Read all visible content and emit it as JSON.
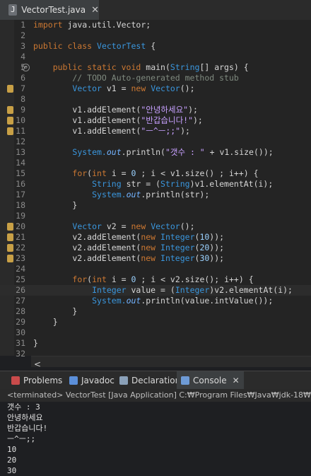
{
  "tab": {
    "title": "VectorTest.java",
    "close": "✕"
  },
  "code_lines": [
    {
      "n": "1",
      "parts": [
        [
          "kw",
          "import "
        ],
        [
          "",
          "java.util.Vector;"
        ]
      ]
    },
    {
      "n": "2",
      "parts": []
    },
    {
      "n": "3",
      "parts": [
        [
          "kw",
          "public class "
        ],
        [
          "ty",
          "VectorTest"
        ],
        [
          "",
          " {"
        ]
      ]
    },
    {
      "n": "4",
      "parts": []
    },
    {
      "n": "5",
      "parts": [
        [
          "",
          "    "
        ],
        [
          "kw",
          "public static void "
        ],
        [
          "fn",
          "main("
        ],
        [
          "ty",
          "String"
        ],
        [
          "",
          "[] args) {"
        ]
      ]
    },
    {
      "n": "6",
      "parts": [
        [
          "cm",
          "        // TODO Auto-generated method stub"
        ]
      ]
    },
    {
      "n": "7",
      "parts": [
        [
          "",
          "        "
        ],
        [
          "ty",
          "Vector"
        ],
        [
          "",
          " v1 = "
        ],
        [
          "kw",
          "new "
        ],
        [
          "ty",
          "Vector"
        ],
        [
          "",
          "();"
        ]
      ]
    },
    {
      "n": "8",
      "parts": []
    },
    {
      "n": "9",
      "parts": [
        [
          "",
          "        v1.addElement("
        ],
        [
          "str",
          "\"안녕하세요\""
        ],
        [
          "",
          ");"
        ]
      ]
    },
    {
      "n": "10",
      "parts": [
        [
          "",
          "        v1.addElement("
        ],
        [
          "str",
          "\"반갑습니다!\""
        ],
        [
          "",
          ");"
        ]
      ]
    },
    {
      "n": "11",
      "parts": [
        [
          "",
          "        v1.addElement("
        ],
        [
          "str",
          "\"ㅡ^ㅡ;;\""
        ],
        [
          "",
          ");"
        ]
      ]
    },
    {
      "n": "12",
      "parts": []
    },
    {
      "n": "13",
      "parts": [
        [
          "",
          "        "
        ],
        [
          "ty",
          "System."
        ],
        [
          "fld",
          "out"
        ],
        [
          "",
          ".println("
        ],
        [
          "str",
          "\"갯수 : \""
        ],
        [
          "",
          " + v1.size());"
        ]
      ]
    },
    {
      "n": "14",
      "parts": []
    },
    {
      "n": "15",
      "parts": [
        [
          "",
          "        "
        ],
        [
          "kw",
          "for"
        ],
        [
          "",
          "("
        ],
        [
          "kw",
          "int "
        ],
        [
          "",
          "i = "
        ],
        [
          "num",
          "0"
        ],
        [
          "",
          " ; i < v1.size() ; i++) {"
        ]
      ]
    },
    {
      "n": "16",
      "parts": [
        [
          "",
          "            "
        ],
        [
          "ty",
          "String"
        ],
        [
          "",
          " str = ("
        ],
        [
          "ty",
          "String"
        ],
        [
          "",
          ")v1.elementAt(i);"
        ]
      ]
    },
    {
      "n": "17",
      "parts": [
        [
          "",
          "            "
        ],
        [
          "ty",
          "System."
        ],
        [
          "fld",
          "out"
        ],
        [
          "",
          ".println(str);"
        ]
      ]
    },
    {
      "n": "18",
      "parts": [
        [
          "",
          "        }"
        ]
      ]
    },
    {
      "n": "19",
      "parts": []
    },
    {
      "n": "20",
      "parts": [
        [
          "",
          "        "
        ],
        [
          "ty",
          "Vector"
        ],
        [
          "",
          " v2 = "
        ],
        [
          "kw",
          "new "
        ],
        [
          "ty",
          "Vector"
        ],
        [
          "",
          "();"
        ]
      ]
    },
    {
      "n": "21",
      "parts": [
        [
          "",
          "        v2.addElement("
        ],
        [
          "kw",
          "new "
        ],
        [
          "ty",
          "Integer"
        ],
        [
          "",
          "("
        ],
        [
          "num",
          "10"
        ],
        [
          "",
          "));"
        ]
      ]
    },
    {
      "n": "22",
      "parts": [
        [
          "",
          "        v2.addElement("
        ],
        [
          "kw",
          "new "
        ],
        [
          "ty",
          "Integer"
        ],
        [
          "",
          "("
        ],
        [
          "num",
          "20"
        ],
        [
          "",
          "));"
        ]
      ]
    },
    {
      "n": "23",
      "parts": [
        [
          "",
          "        v2.addElement("
        ],
        [
          "kw",
          "new "
        ],
        [
          "ty",
          "Integer"
        ],
        [
          "",
          "("
        ],
        [
          "num",
          "30"
        ],
        [
          "",
          "));"
        ]
      ]
    },
    {
      "n": "24",
      "parts": []
    },
    {
      "n": "25",
      "parts": [
        [
          "",
          "        "
        ],
        [
          "kw",
          "for"
        ],
        [
          "",
          "("
        ],
        [
          "kw",
          "int "
        ],
        [
          "",
          "i = "
        ],
        [
          "num",
          "0"
        ],
        [
          "",
          " ; i < v2.size(); i++) {"
        ]
      ]
    },
    {
      "n": "26",
      "parts": [
        [
          "",
          "            "
        ],
        [
          "ty",
          "Integer"
        ],
        [
          "",
          " value = ("
        ],
        [
          "ty",
          "Integer"
        ],
        [
          "",
          ")v2.elementAt(i);"
        ]
      ]
    },
    {
      "n": "27",
      "parts": [
        [
          "",
          "            "
        ],
        [
          "ty",
          "System."
        ],
        [
          "fld",
          "out"
        ],
        [
          "",
          ".println(value.intValue());"
        ]
      ]
    },
    {
      "n": "28",
      "parts": [
        [
          "",
          "        }"
        ]
      ]
    },
    {
      "n": "29",
      "parts": [
        [
          "",
          "    }"
        ]
      ]
    },
    {
      "n": "30",
      "parts": []
    },
    {
      "n": "31",
      "parts": [
        [
          "",
          "}"
        ]
      ]
    },
    {
      "n": "32",
      "parts": []
    }
  ],
  "warning_lines": [
    "7",
    "9",
    "10",
    "11",
    "20",
    "21",
    "22",
    "23"
  ],
  "highlight_line": "26",
  "console_tabs": [
    {
      "label": "Problems",
      "icon": "problems-icon",
      "color": "#c94b4b"
    },
    {
      "label": "Javadoc",
      "icon": "javadoc-icon",
      "color": "#5b8fd9"
    },
    {
      "label": "Declaration",
      "icon": "declaration-icon",
      "color": "#8aa0b8"
    },
    {
      "label": "Console",
      "icon": "console-icon",
      "color": "#6e9bd6",
      "active": true
    }
  ],
  "console_close": "✕",
  "terminated": "<terminated> VectorTest [Java Application] C:₩Program Files₩Java₩jdk-18₩bin",
  "output": [
    "갯수 : 3",
    "안녕하세요",
    "반갑습니다!",
    "ㅡ^ㅡ;;",
    "10",
    "20",
    "30"
  ],
  "scroll_arrow": "<",
  "fold_marker": "⊖"
}
